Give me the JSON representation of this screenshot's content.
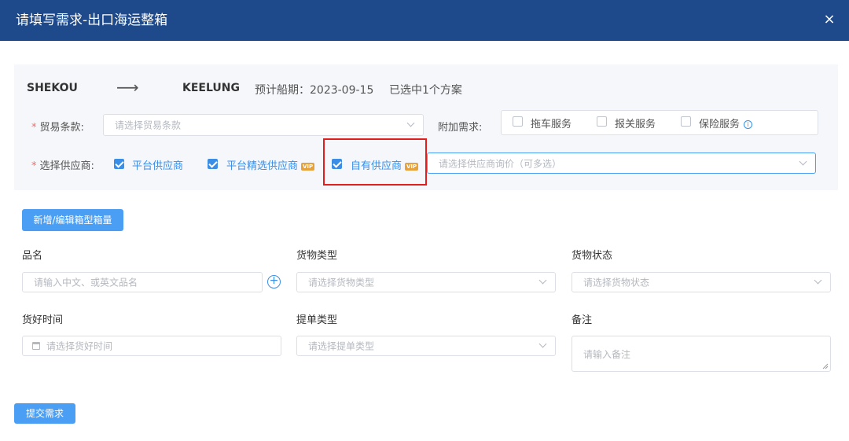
{
  "dialog": {
    "title": "请填写需求-出口海运整箱",
    "close_glyph": "×"
  },
  "route": {
    "origin": "SHEKOU",
    "arrow": "⟶",
    "destination": "KEELUNG",
    "etd_label": "预计船期：",
    "etd_value": "2023-09-15",
    "selected_text": "已选中1个方案"
  },
  "trade_terms": {
    "required_mark": "*",
    "label": "贸易条款:",
    "placeholder": "请选择贸易条款"
  },
  "extra": {
    "label": "附加需求:",
    "options": [
      {
        "label": "拖车服务",
        "checked": false
      },
      {
        "label": "报关服务",
        "checked": false
      },
      {
        "label": "保险服务",
        "checked": false
      }
    ],
    "info_glyph": "i"
  },
  "supplier": {
    "required_mark": "*",
    "label": "选择供应商:",
    "options": [
      {
        "label": "平台供应商",
        "checked": true,
        "vip": false
      },
      {
        "label": "平台精选供应商",
        "checked": true,
        "vip": true
      },
      {
        "label": "自有供应商",
        "checked": true,
        "vip": true
      }
    ],
    "vip_text": "VIP",
    "select_placeholder": "请选择供应商询价（可多选）"
  },
  "add_box_button": "新增/编辑箱型箱量",
  "form": {
    "product_name": {
      "label": "品名",
      "placeholder": "请输入中文、或英文品名"
    },
    "cargo_type": {
      "label": "货物类型",
      "placeholder": "请选择货物类型"
    },
    "cargo_status": {
      "label": "货物状态",
      "placeholder": "请选择货物状态"
    },
    "ready_time": {
      "label": "货好时间",
      "placeholder": "请选择货好时间"
    },
    "bl_type": {
      "label": "提单类型",
      "placeholder": "请选择提单类型"
    },
    "remark": {
      "label": "备注",
      "placeholder": "请输入备注"
    }
  },
  "plus_glyph": "+",
  "submit_button": "提交需求",
  "colors": {
    "header": "#1e4a8c",
    "accent": "#3a8ee6",
    "button": "#4a9ff5",
    "highlight": "#e01e1e"
  }
}
